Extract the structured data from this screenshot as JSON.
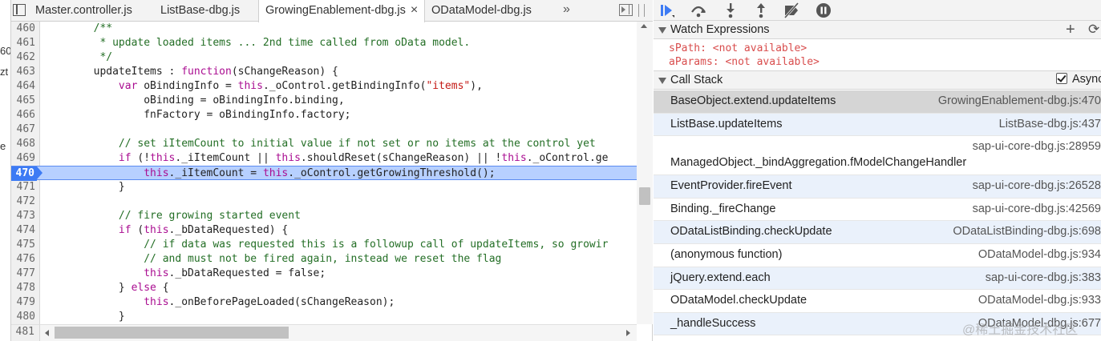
{
  "left_fragments": [
    "60",
    "zt",
    "e"
  ],
  "tabs": [
    {
      "label": "Master.controller.js",
      "active": false
    },
    {
      "label": "ListBase-dbg.js",
      "active": false
    },
    {
      "label": "GrowingEnablement-dbg.js",
      "active": true
    },
    {
      "label": "ODataModel-dbg.js",
      "active": false
    }
  ],
  "tab_close_glyph": "×",
  "more_tabs_glyph": "»",
  "code_lines": [
    {
      "n": "460",
      "segs": [
        {
          "t": "        ",
          "c": ""
        },
        {
          "t": "/**",
          "c": "tk-c"
        }
      ]
    },
    {
      "n": "461",
      "segs": [
        {
          "t": "         * update loaded items ... 2nd time called from oData model.",
          "c": "tk-c"
        }
      ]
    },
    {
      "n": "462",
      "segs": [
        {
          "t": "         */",
          "c": "tk-c"
        }
      ]
    },
    {
      "n": "463",
      "segs": [
        {
          "t": "        updateItems : ",
          "c": ""
        },
        {
          "t": "function",
          "c": "tk-k"
        },
        {
          "t": "(sChangeReason) {",
          "c": ""
        }
      ]
    },
    {
      "n": "464",
      "segs": [
        {
          "t": "            ",
          "c": ""
        },
        {
          "t": "var",
          "c": "tk-k"
        },
        {
          "t": " oBindingInfo = ",
          "c": ""
        },
        {
          "t": "this",
          "c": "tk-k"
        },
        {
          "t": "._oControl.getBindingInfo(",
          "c": ""
        },
        {
          "t": "\"items\"",
          "c": "tk-s"
        },
        {
          "t": "),",
          "c": ""
        }
      ]
    },
    {
      "n": "465",
      "segs": [
        {
          "t": "                oBinding = oBindingInfo.binding,",
          "c": ""
        }
      ]
    },
    {
      "n": "466",
      "segs": [
        {
          "t": "                fnFactory = oBindingInfo.factory;",
          "c": ""
        }
      ]
    },
    {
      "n": "467",
      "segs": [
        {
          "t": "",
          "c": ""
        }
      ]
    },
    {
      "n": "468",
      "segs": [
        {
          "t": "            ",
          "c": ""
        },
        {
          "t": "// set iItemCount to initial value if not set or no items at the control yet",
          "c": "tk-c"
        }
      ]
    },
    {
      "n": "469",
      "segs": [
        {
          "t": "            ",
          "c": ""
        },
        {
          "t": "if",
          "c": "tk-k"
        },
        {
          "t": " (!",
          "c": ""
        },
        {
          "t": "this",
          "c": "tk-k"
        },
        {
          "t": "._iItemCount || ",
          "c": ""
        },
        {
          "t": "this",
          "c": "tk-k"
        },
        {
          "t": ".shouldReset(sChangeReason) || !",
          "c": ""
        },
        {
          "t": "this",
          "c": "tk-k"
        },
        {
          "t": "._oControl.ge",
          "c": ""
        }
      ]
    },
    {
      "n": "470",
      "exec": true,
      "segs": [
        {
          "t": "                ",
          "c": ""
        },
        {
          "t": "this",
          "c": "tk-k"
        },
        {
          "t": "._iItemCount = ",
          "c": ""
        },
        {
          "t": "this",
          "c": "tk-k"
        },
        {
          "t": "._oControl.getGrowingThreshold();",
          "c": ""
        }
      ]
    },
    {
      "n": "471",
      "segs": [
        {
          "t": "            }",
          "c": ""
        }
      ]
    },
    {
      "n": "472",
      "segs": [
        {
          "t": "",
          "c": ""
        }
      ]
    },
    {
      "n": "473",
      "segs": [
        {
          "t": "            ",
          "c": ""
        },
        {
          "t": "// fire growing started event",
          "c": "tk-c"
        }
      ]
    },
    {
      "n": "474",
      "segs": [
        {
          "t": "            ",
          "c": ""
        },
        {
          "t": "if",
          "c": "tk-k"
        },
        {
          "t": " (",
          "c": ""
        },
        {
          "t": "this",
          "c": "tk-k"
        },
        {
          "t": "._bDataRequested) {",
          "c": ""
        }
      ]
    },
    {
      "n": "475",
      "segs": [
        {
          "t": "                ",
          "c": ""
        },
        {
          "t": "// if data was requested this is a followup call of updateItems, so growir",
          "c": "tk-c"
        }
      ]
    },
    {
      "n": "476",
      "segs": [
        {
          "t": "                ",
          "c": ""
        },
        {
          "t": "// and must not be fired again, instead we reset the flag",
          "c": "tk-c"
        }
      ]
    },
    {
      "n": "477",
      "segs": [
        {
          "t": "                ",
          "c": ""
        },
        {
          "t": "this",
          "c": "tk-k"
        },
        {
          "t": "._bDataRequested = false;",
          "c": ""
        }
      ]
    },
    {
      "n": "478",
      "segs": [
        {
          "t": "            } ",
          "c": ""
        },
        {
          "t": "else",
          "c": "tk-k"
        },
        {
          "t": " {",
          "c": ""
        }
      ]
    },
    {
      "n": "479",
      "segs": [
        {
          "t": "                ",
          "c": ""
        },
        {
          "t": "this",
          "c": "tk-k"
        },
        {
          "t": "._onBeforePageLoaded(sChangeReason);",
          "c": ""
        }
      ]
    },
    {
      "n": "480",
      "segs": [
        {
          "t": "            }",
          "c": ""
        }
      ]
    }
  ],
  "last_line_number": "481",
  "watch": {
    "title": "Watch Expressions",
    "add_glyph": "+",
    "refresh_glyph": "⟳",
    "items": [
      {
        "name": "sPath",
        "value": "<not available>"
      },
      {
        "name": "aParams",
        "value": "<not available>"
      }
    ]
  },
  "call_stack": {
    "title": "Call Stack",
    "async_label": "Async",
    "async_checked": true,
    "frames": [
      {
        "name": "BaseObject.extend.updateItems",
        "location": "GrowingEnablement-dbg.js:470",
        "selected": true
      },
      {
        "name": "ListBase.updateItems",
        "location": "ListBase-dbg.js:437"
      },
      {
        "name": "ManagedObject._bindAggregation.fModelChangeHandler",
        "location": "sap-ui-core-dbg.js:28959",
        "wrap": true
      },
      {
        "name": "EventProvider.fireEvent",
        "location": "sap-ui-core-dbg.js:26528"
      },
      {
        "name": "Binding._fireChange",
        "location": "sap-ui-core-dbg.js:42569"
      },
      {
        "name": "ODataListBinding.checkUpdate",
        "location": "ODataListBinding-dbg.js:698"
      },
      {
        "name": "(anonymous function)",
        "location": "ODataModel-dbg.js:934"
      },
      {
        "name": "jQuery.extend.each",
        "location": "sap-ui-core-dbg.js:383"
      },
      {
        "name": "ODataModel.checkUpdate",
        "location": "ODataModel-dbg.js:933"
      },
      {
        "name": "_handleSuccess",
        "location": "ODataModel-dbg.js:677"
      }
    ]
  },
  "watermark": "@稀土掘金技术社区"
}
